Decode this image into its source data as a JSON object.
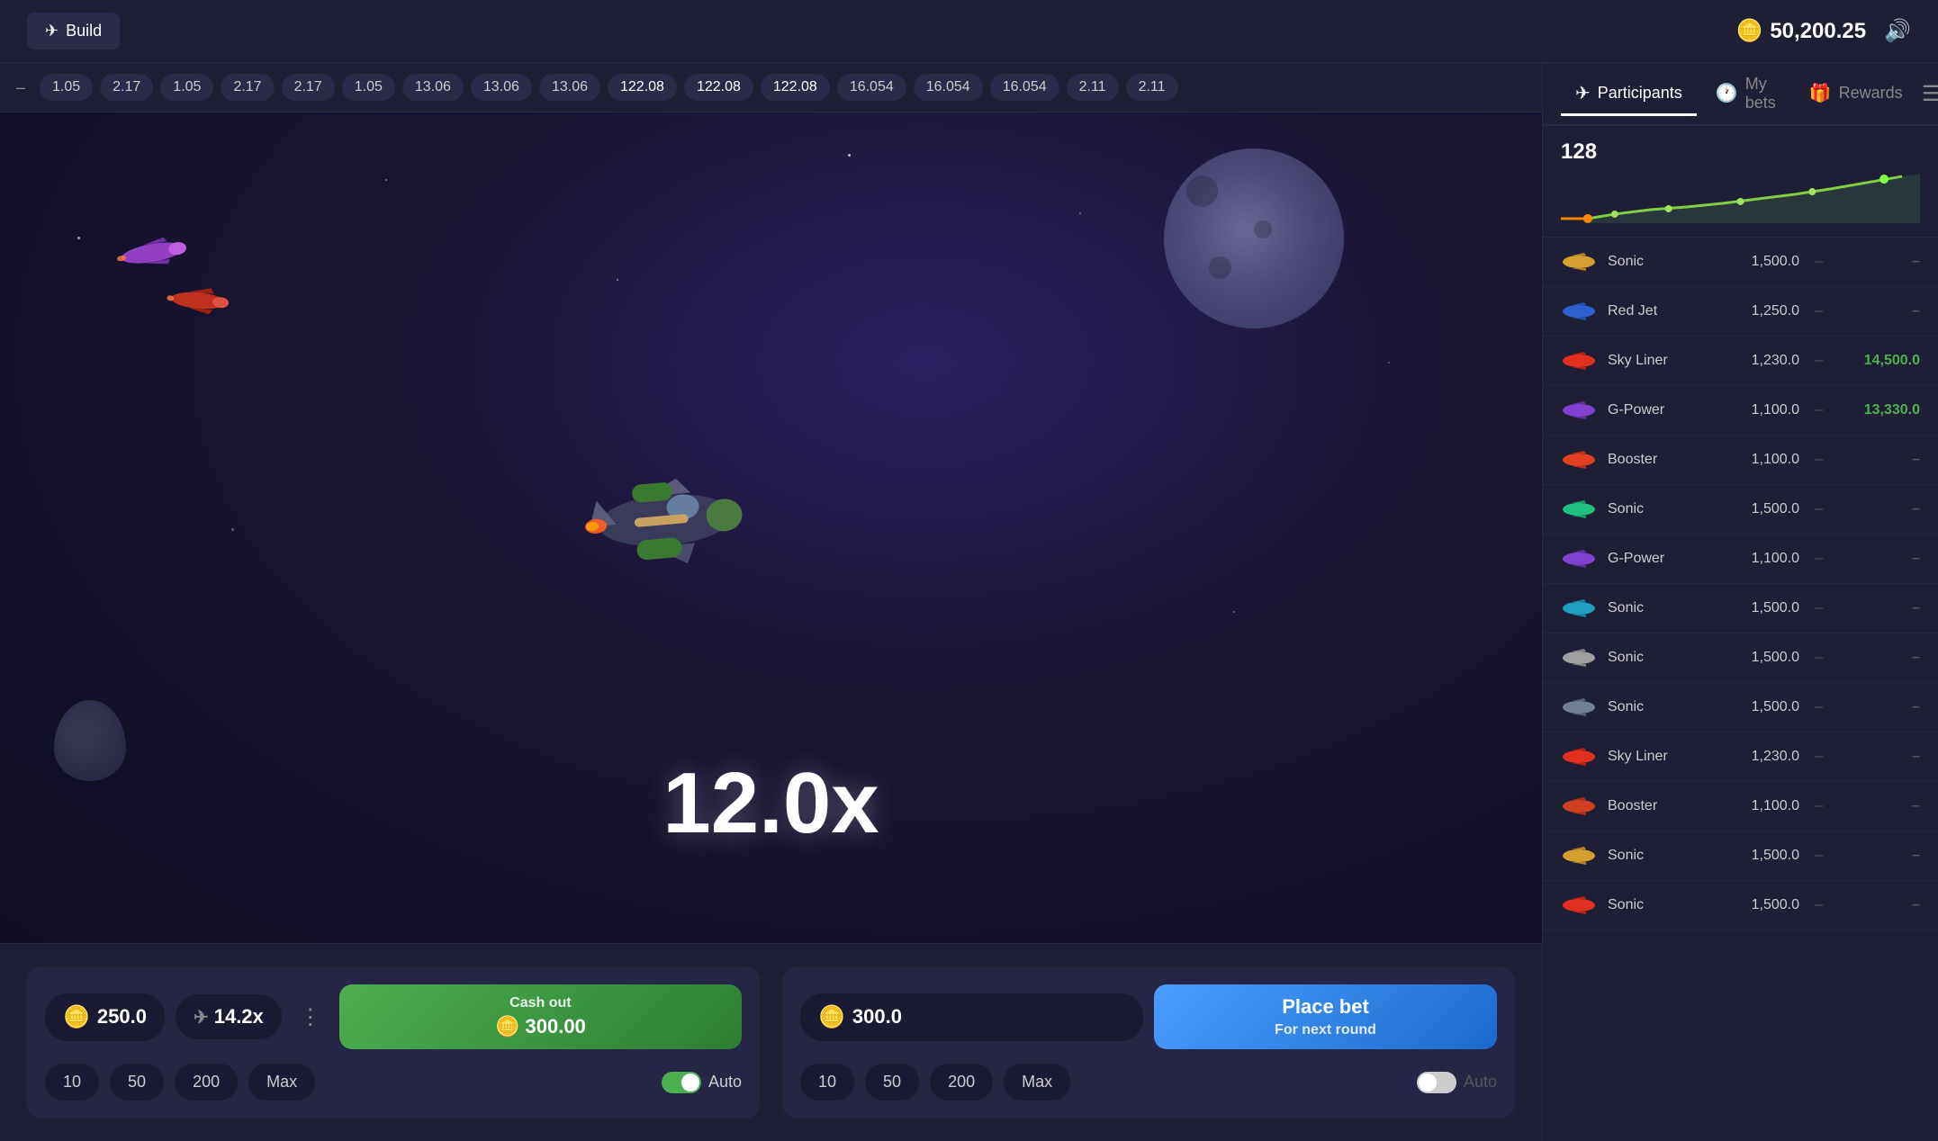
{
  "header": {
    "build_label": "Build",
    "balance": "50,200.25",
    "balance_icon": "🪙"
  },
  "multiplier_bar": {
    "dash": "–",
    "values": [
      "1.05",
      "2.17",
      "1.05",
      "2.17",
      "2.17",
      "1.05",
      "13.06",
      "13.06",
      "13.06",
      "122.08",
      "122.08",
      "122.08",
      "16.054",
      "16.054",
      "16.054",
      "2.11",
      "2.11"
    ]
  },
  "game": {
    "multiplier": "12.0x"
  },
  "right_panel": {
    "tabs": [
      {
        "label": "Participants",
        "icon": "✈",
        "active": true
      },
      {
        "label": "My bets",
        "icon": "🕐",
        "active": false
      },
      {
        "label": "Rewards",
        "icon": "🎁",
        "active": false
      }
    ],
    "chart_number": "128",
    "participants": [
      {
        "name": "Sonic",
        "plane_color": "#d4a030",
        "bet": "1,500.0",
        "dash1": "–",
        "win": "–"
      },
      {
        "name": "Red Jet",
        "plane_color": "#3060d0",
        "bet": "1,250.0",
        "dash1": "–",
        "win": "–"
      },
      {
        "name": "Sky Liner",
        "plane_color": "#e03020",
        "bet": "1,230.0",
        "dash1": "–",
        "win": "14,500.0",
        "win_green": true
      },
      {
        "name": "G-Power",
        "plane_color": "#8040d0",
        "bet": "1,100.0",
        "dash1": "–",
        "win": "13,330.0",
        "win_green": true
      },
      {
        "name": "Booster",
        "plane_color": "#e04020",
        "bet": "1,100.0",
        "dash1": "–",
        "win": "–"
      },
      {
        "name": "Sonic",
        "plane_color": "#20c080",
        "bet": "1,500.0",
        "dash1": "–",
        "win": "–"
      },
      {
        "name": "G-Power",
        "plane_color": "#8040d0",
        "bet": "1,100.0",
        "dash1": "–",
        "win": "–"
      },
      {
        "name": "Sonic",
        "plane_color": "#20a0c0",
        "bet": "1,500.0",
        "dash1": "–",
        "win": "–"
      },
      {
        "name": "Sonic",
        "plane_color": "#a0a0a0",
        "bet": "1,500.0",
        "dash1": "–",
        "win": "–"
      },
      {
        "name": "Sonic",
        "plane_color": "#708090",
        "bet": "1,500.0",
        "dash1": "–",
        "win": "–"
      },
      {
        "name": "Sky Liner",
        "plane_color": "#e03020",
        "bet": "1,230.0",
        "dash1": "–",
        "win": "–"
      },
      {
        "name": "Booster",
        "plane_color": "#d04020",
        "bet": "1,100.0",
        "dash1": "–",
        "win": "–"
      },
      {
        "name": "Sonic",
        "plane_color": "#d4a030",
        "bet": "1,500.0",
        "dash1": "–",
        "win": "–"
      },
      {
        "name": "Sonic",
        "plane_color": "#e03020",
        "bet": "1,500.0",
        "dash1": "–",
        "win": "–"
      }
    ]
  },
  "bet_panel_1": {
    "amount": "250.0",
    "multiplier": "14.2x",
    "cashout_label": "Cash out",
    "cashout_amount": "300.00",
    "quick_bets": [
      "10",
      "50",
      "200",
      "Max"
    ],
    "auto_label": "Auto",
    "auto_active": true
  },
  "bet_panel_2": {
    "amount": "300.0",
    "place_bet_label": "Place bet",
    "place_bet_sub": "For next round",
    "quick_bets": [
      "10",
      "50",
      "200",
      "Max"
    ],
    "auto_label": "Auto",
    "auto_active": false
  }
}
